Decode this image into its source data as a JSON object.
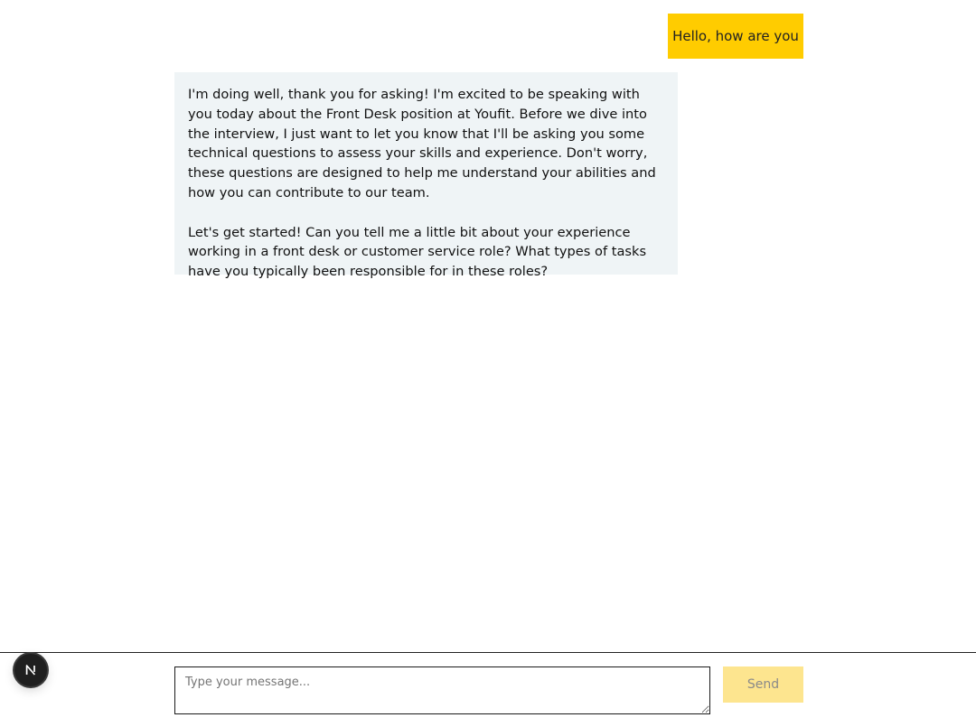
{
  "chat": {
    "messages": [
      {
        "role": "user",
        "text": "Hello, how are you"
      },
      {
        "role": "assistant",
        "paragraphs": [
          "I'm doing well, thank you for asking! I'm excited to be speaking with you today about the Front Desk position at Youfit. Before we dive into the interview, I just want to let you know that I'll be asking you some technical questions to assess your skills and experience. Don't worry, these questions are designed to help me understand your abilities and how you can contribute to our team.",
          "Let's get started! Can you tell me a little bit about your experience working in a front desk or customer service role? What types of tasks have you typically been responsible for in these roles?"
        ]
      }
    ]
  },
  "composer": {
    "placeholder": "Type your message...",
    "value": "",
    "send_label": "Send"
  },
  "badge": {
    "icon": "nextjs-logo-icon"
  },
  "colors": {
    "user_bubble": "#ffcc00",
    "assistant_bubble": "#eff4f6",
    "send_disabled": "#fde58f",
    "badge": "#1f1f1f"
  }
}
